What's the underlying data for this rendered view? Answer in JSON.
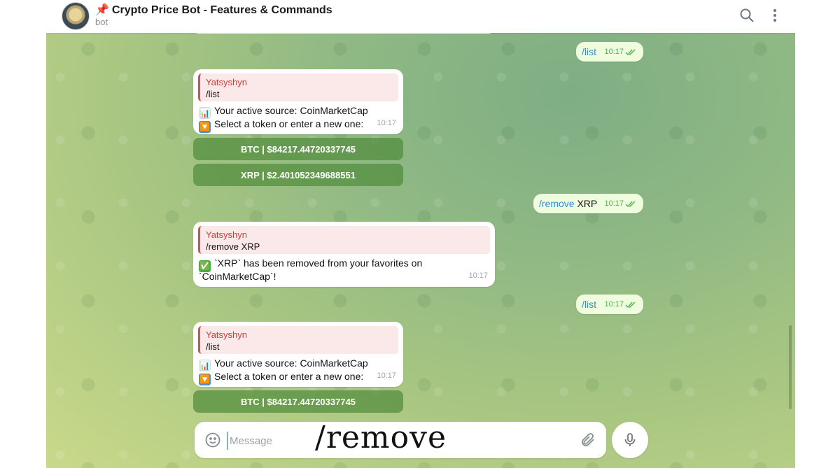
{
  "header": {
    "pin": "📌",
    "title": "Crypto Price Bot - Features & Commands",
    "subtitle": "bot"
  },
  "messages": {
    "out1": {
      "cmd": "/list",
      "time": "10:17"
    },
    "in1": {
      "reply_name": "Yatsyshyn",
      "reply_text": "/list",
      "line1": "Your active source: CoinMarketCap",
      "line2": "Select a token or enter a new one:",
      "time": "10:17",
      "buttons": [
        "BTC | $84217.44720337745",
        "XRP | $2.401052349688551"
      ]
    },
    "out2": {
      "cmd": "/remove",
      "arg": " XRP",
      "time": "10:17"
    },
    "in2": {
      "reply_name": "Yatsyshyn",
      "reply_text": "/remove XRP",
      "line1": "`XRP` has been removed from your favorites on",
      "line2": "`CoinMarketCap`!",
      "time": "10:17"
    },
    "out3": {
      "cmd": "/list",
      "time": "10:17"
    },
    "in3": {
      "reply_name": "Yatsyshyn",
      "reply_text": "/list",
      "line1": "Your active source: CoinMarketCap",
      "line2": "Select a token or enter a new one:",
      "time": "10:17",
      "buttons": [
        "BTC | $84217.44720337745"
      ]
    }
  },
  "composer": {
    "placeholder": "Message",
    "overlay_text": "/remove"
  },
  "icons": {
    "search": "search-icon",
    "more": "more-vertical-icon",
    "emoji": "smile-icon",
    "attach": "paperclip-icon",
    "mic": "microphone-icon",
    "bar_chart": "📊",
    "down_arrow": "🔽",
    "check_mark": "✅"
  },
  "colors": {
    "outgoing_bubble": "#effdde",
    "command_link": "#2f8fd6",
    "reply_name": "#d23a3a",
    "keyboard_button": "#5a8c3c"
  }
}
